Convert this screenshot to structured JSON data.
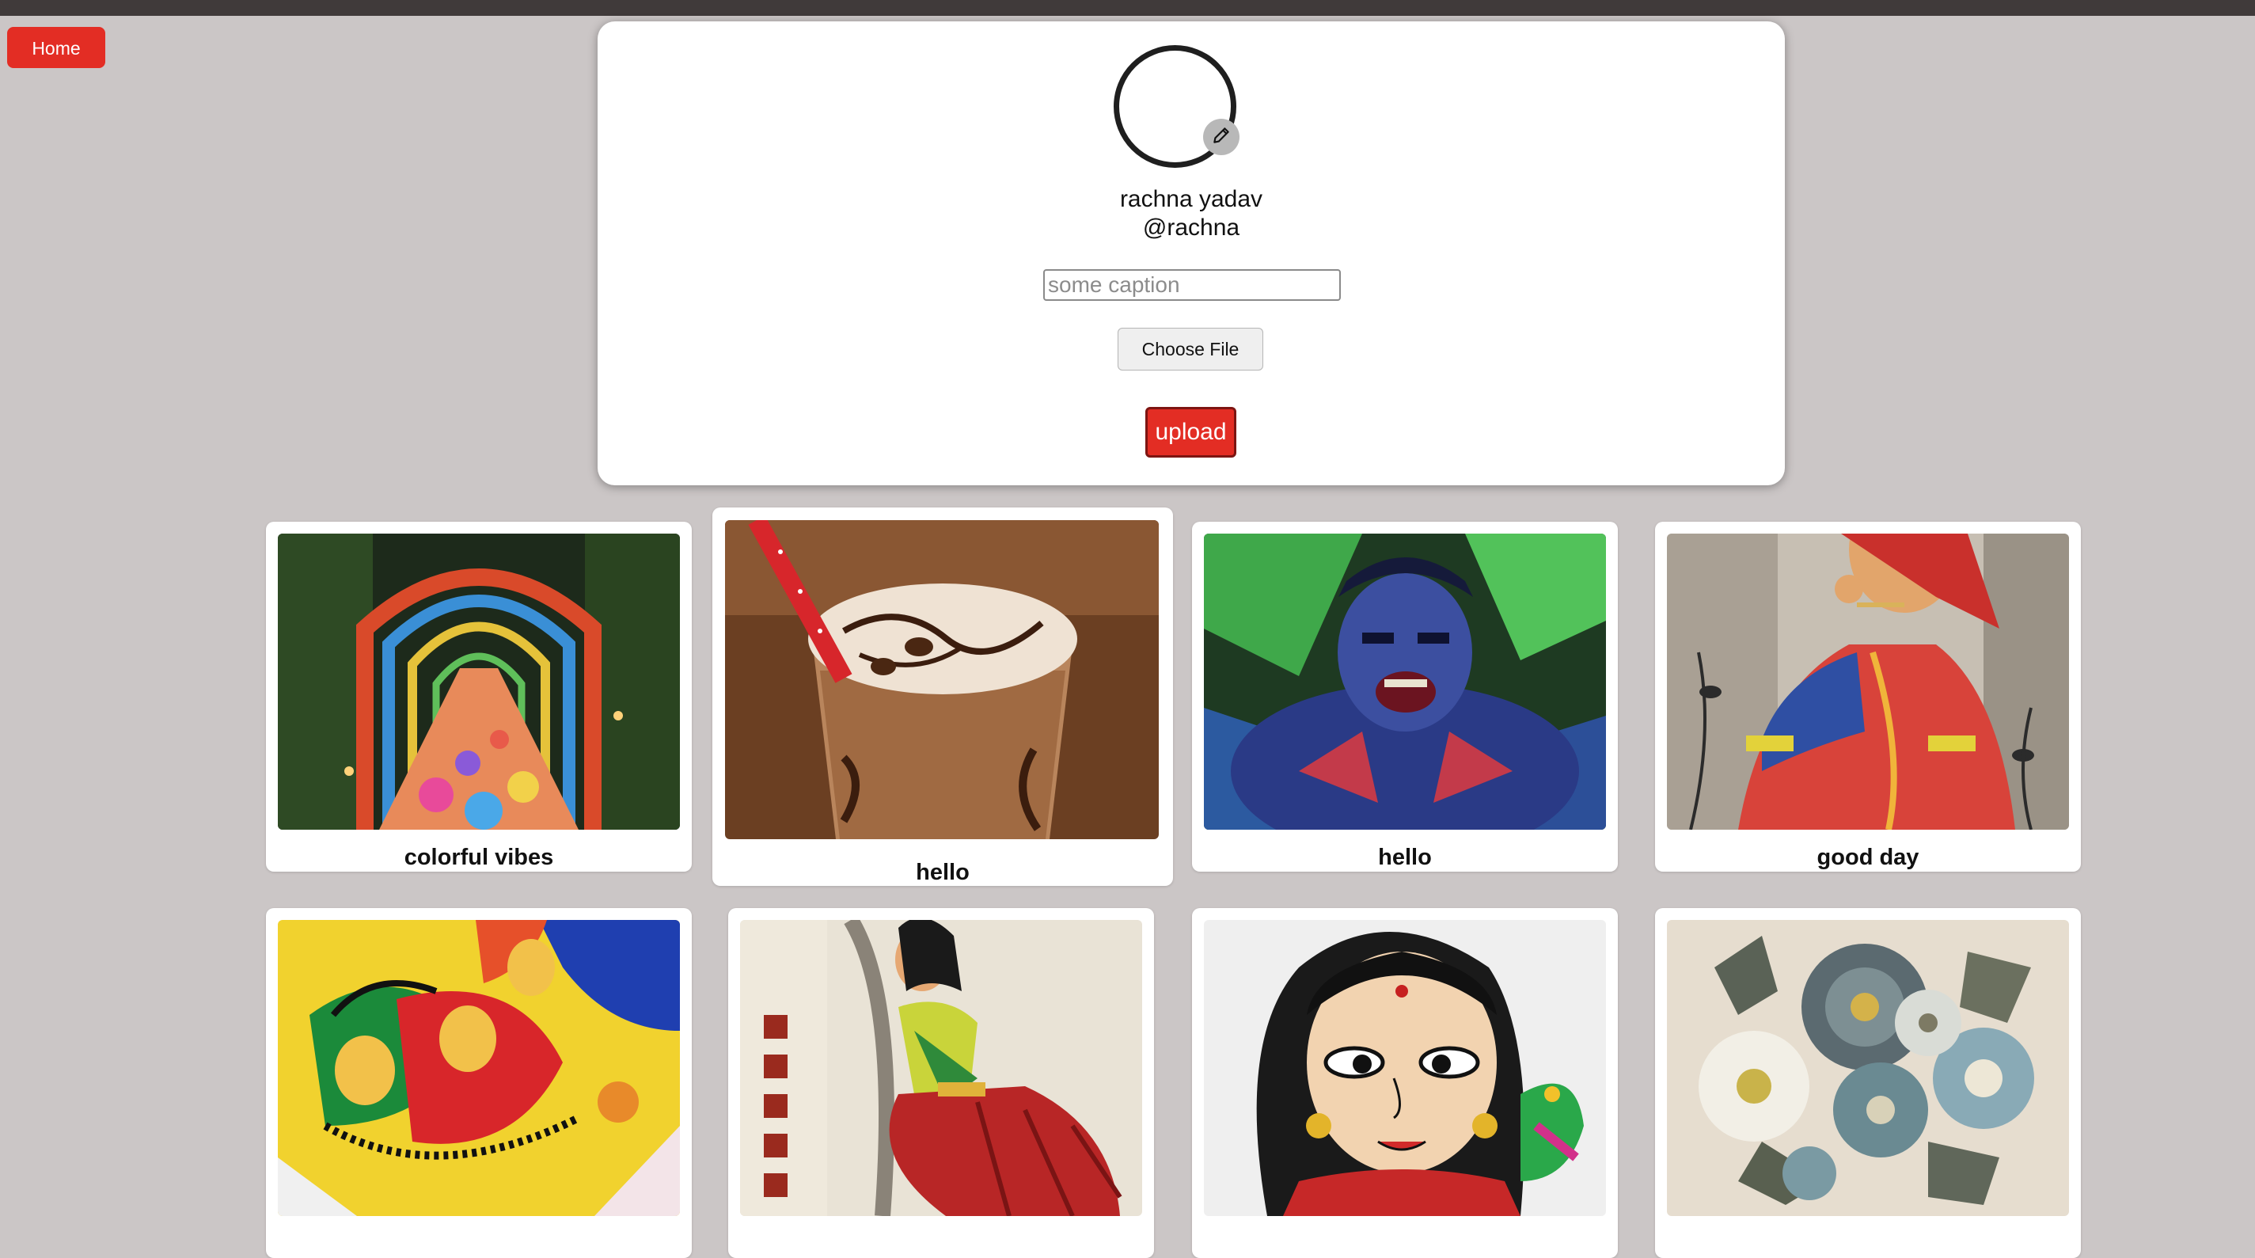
{
  "nav": {
    "home_label": "Home"
  },
  "profile": {
    "full_name": "rachna yadav",
    "username": "@rachna",
    "caption_placeholder": "some caption",
    "choose_file_label": "Choose File",
    "upload_label": "upload"
  },
  "posts": [
    {
      "caption": "colorful vibes",
      "image": "stained-glass-garden-path"
    },
    {
      "caption": "hello",
      "image": "iced-coffee-frappe"
    },
    {
      "caption": "hello",
      "image": "hulk-illustration"
    },
    {
      "caption": "good day",
      "image": "woman-in-red-saree-painting"
    },
    {
      "caption": "",
      "image": "folk-art-women-painting"
    },
    {
      "caption": "",
      "image": "dancer-on-fabric-painting"
    },
    {
      "caption": "",
      "image": "woman-with-parrot-painting"
    },
    {
      "caption": "",
      "image": "metal-flower-wall-art"
    }
  ],
  "colors": {
    "accent": "#e32d24",
    "page_background": "#cbc6c6",
    "top_bar": "#403a3a"
  }
}
